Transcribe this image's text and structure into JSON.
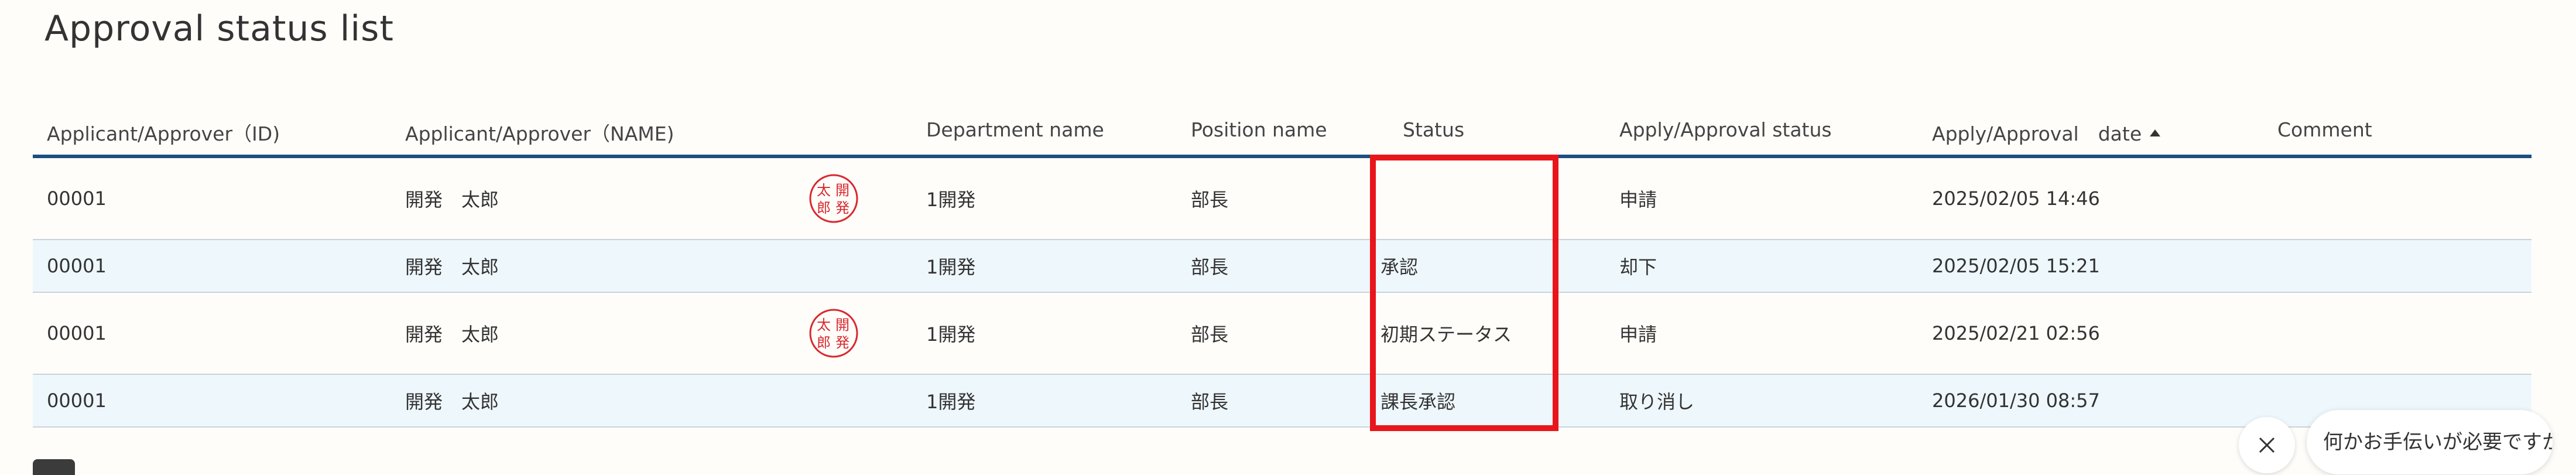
{
  "page": {
    "title": "Approval status list"
  },
  "table": {
    "columns": [
      {
        "key": "id",
        "label": "Applicant/Approver（ID)"
      },
      {
        "key": "name",
        "label": "Applicant/Approver（NAME)"
      },
      {
        "key": "department",
        "label": "Department name"
      },
      {
        "key": "position",
        "label": "Position name"
      },
      {
        "key": "status",
        "label": "Status"
      },
      {
        "key": "apply_status",
        "label": "Apply/Approval status"
      },
      {
        "key": "date",
        "label": "Apply/Approval　date"
      },
      {
        "key": "comment",
        "label": "Comment"
      }
    ],
    "sort": {
      "column": "date",
      "direction": "ascending",
      "icon": "sort-up-icon"
    },
    "rows": [
      {
        "id": "00001",
        "name": "開発　太郎",
        "has_seal": true,
        "seal_text": [
          "太",
          "開",
          "郎",
          "発"
        ],
        "department": "1開発",
        "position": "部長",
        "status": "",
        "apply_status": "申請",
        "date": "2025/02/05 14:46",
        "comment": ""
      },
      {
        "id": "00001",
        "name": "開発　太郎",
        "has_seal": false,
        "seal_text": [],
        "department": "1開発",
        "position": "部長",
        "status": "承認",
        "apply_status": "却下",
        "date": "2025/02/05 15:21",
        "comment": ""
      },
      {
        "id": "00001",
        "name": "開発　太郎",
        "has_seal": true,
        "seal_text": [
          "太",
          "開",
          "郎",
          "発"
        ],
        "department": "1開発",
        "position": "部長",
        "status": "初期ステータス",
        "apply_status": "申請",
        "date": "2025/02/21 02:56",
        "comment": ""
      },
      {
        "id": "00001",
        "name": "開発　太郎",
        "has_seal": false,
        "seal_text": [],
        "department": "1開発",
        "position": "部長",
        "status": "課長承認",
        "apply_status": "取り消し",
        "date": "2026/01/30 08:57",
        "comment": ""
      }
    ]
  },
  "chat": {
    "prompt": "何かお手伝いが必要ですか？",
    "close_icon": "close-icon"
  },
  "colors": {
    "header_border": "#1c4f7f",
    "alt_row": "#eef7fc",
    "highlight": "#e8161b",
    "seal": "#d9282f"
  }
}
